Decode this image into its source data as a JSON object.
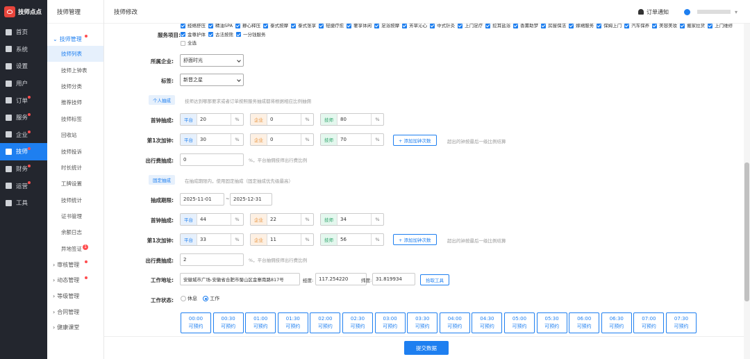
{
  "app": {
    "title": "技师点点"
  },
  "nav": [
    {
      "label": "首页",
      "icon": "monitor-icon",
      "dot": false
    },
    {
      "label": "系统",
      "icon": "sitemap-icon",
      "dot": false
    },
    {
      "label": "设置",
      "icon": "gear-icon",
      "dot": false
    },
    {
      "label": "用户",
      "icon": "user-icon",
      "dot": false
    },
    {
      "label": "订单",
      "icon": "clipboard-icon",
      "dot": true
    },
    {
      "label": "服务",
      "icon": "link-icon",
      "dot": true
    },
    {
      "label": "企业",
      "icon": "building-icon",
      "dot": true
    },
    {
      "label": "技师",
      "icon": "person-icon",
      "dot": true,
      "active": true
    },
    {
      "label": "财务",
      "icon": "chart-icon",
      "dot": true
    },
    {
      "label": "运营",
      "icon": "fire-icon",
      "dot": true
    },
    {
      "label": "工具",
      "icon": "briefcase-icon",
      "dot": false
    }
  ],
  "sub": {
    "header": "技师管理",
    "open_group": "技师管理",
    "items": [
      "技师列表",
      "技师上钟表",
      "技师分类",
      "推荐技师",
      "技师标签",
      "回收站",
      "技师投诉",
      "时长统计",
      "工牌设置",
      "技师统计",
      "证书管理",
      "余额日志",
      "异地签证"
    ],
    "active_index": 0,
    "badge_item": "1",
    "groups": [
      "审核管理",
      "动态管理",
      "等级管理",
      "合同管理",
      "健康课堂"
    ]
  },
  "top": {
    "title": "技师修改",
    "notify": "订单通知"
  },
  "form": {
    "service_label": "服务项目:",
    "services": [
      "经络舒压",
      "精油SPA",
      "静心释压",
      "泰式按摩",
      "泰式张享",
      "轻捷疗愈",
      "奢享体闲",
      "足浴按摩",
      "芳草沁心",
      "中式针灸",
      "上门足疗",
      "挖耳盐浴",
      "香薰助梦",
      "房屋保洁",
      "嫁裙服务",
      "保姆上门",
      "汽车保养",
      "美容美妆",
      "搬家拉货",
      "上门维修",
      "金尊护体",
      "古法按熊",
      "一分钱服务"
    ],
    "select_all": "全选",
    "company_label": "所属企业:",
    "company_value": "舒面时光",
    "tag_label": "标签:",
    "tag_value": "新晋之星",
    "personal_tag": "个人抽成",
    "personal_hint": "技师达到哪那要求或者订单按照服务抽成都将根据相应比例抽佣",
    "first_label": "首钟抽成:",
    "extra_label": "第1次加钟:",
    "travel_label": "出行费抽成:",
    "fixed_tag": "固定抽成",
    "fixed_hint": "在抽成期限内，使用固定抽成（固定抽成优先级最高）",
    "period_label": "抽成期限:",
    "period_start": "2025-11-01",
    "period_sep": "~",
    "period_end": "2025-12-31",
    "pre_platform": "平台",
    "pre_company": "企业",
    "pre_tech": "技师",
    "pct": "%",
    "add_btn": "+ 添加加钟次数",
    "add_hint": "超出的钟按最后一级比例结算",
    "travel_hint": "%，平台抽佣技师出行费比例",
    "personal_first": [
      "20",
      "0",
      "80"
    ],
    "personal_extra": [
      "30",
      "0",
      "70"
    ],
    "personal_travel": "0",
    "fixed_first": [
      "44",
      "22",
      "34"
    ],
    "fixed_extra": [
      "33",
      "11",
      "56"
    ],
    "fixed_travel": "2",
    "addr_label": "工作地址:",
    "address": "安徽城市广场-安徽省合肥市蜀山区金寨南路817号",
    "lng_label": "经度:",
    "lng": "117.254220",
    "lat_label": "纬度:",
    "lat": "31.819934",
    "pick_btn": "拾取工具",
    "status_label": "工作状态:",
    "status_rest": "休息",
    "status_work": "工作",
    "slot_sub": "可预约",
    "slots": [
      "00:00",
      "00:30",
      "01:00",
      "01:30",
      "02:00",
      "02:30",
      "03:00",
      "03:30",
      "04:00",
      "04:30",
      "05:00",
      "05:30",
      "06:00",
      "06:30",
      "07:00",
      "07:30"
    ]
  },
  "submit": "提交数据"
}
